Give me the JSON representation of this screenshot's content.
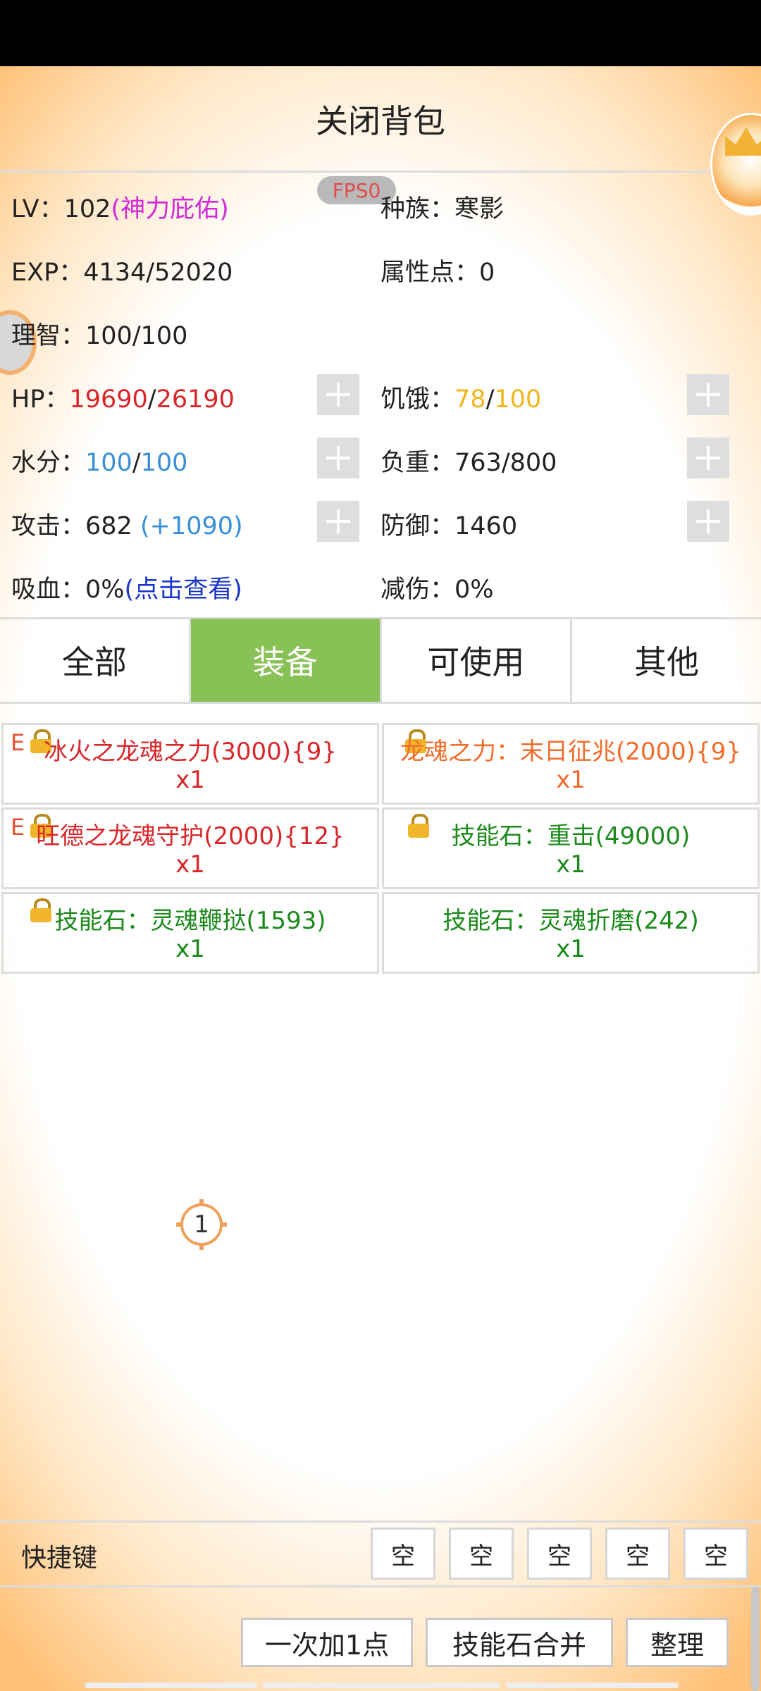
{
  "header": {
    "title": "关闭背包",
    "fps": "FPS0"
  },
  "stats": {
    "lv_label": "LV：",
    "lv_value": "102",
    "lv_buff": "(神力庇佑)",
    "race_label": "种族：",
    "race_value": "寒影",
    "exp_label": "EXP：",
    "exp_value": "4134/52020",
    "attr_label": "属性点：",
    "attr_value": "0",
    "sanity_label": "理智：",
    "sanity_value": "100/100",
    "hp_label": "HP：",
    "hp_current": "19690",
    "hp_sep": "/",
    "hp_max": "26190",
    "hunger_label": "饥饿：",
    "hunger_current": "78",
    "hunger_sep": "/",
    "hunger_max": "100",
    "water_label": "水分：",
    "water_current": "100",
    "water_sep": "/",
    "water_max": "100",
    "load_label": "负重：",
    "load_value": "763/800",
    "attack_label": "攻击：",
    "attack_value": "682",
    "attack_bonus": "(+1090)",
    "defense_label": "防御：",
    "defense_value": "1460",
    "lifesteal_label": "吸血：",
    "lifesteal_value": "0%",
    "lifesteal_link": "(点击查看)",
    "reduction_label": "减伤：",
    "reduction_value": "0%"
  },
  "tabs": [
    {
      "label": "全部",
      "active": false
    },
    {
      "label": "装备",
      "active": true
    },
    {
      "label": "可使用",
      "active": false
    },
    {
      "label": "其他",
      "active": false
    }
  ],
  "items": [
    {
      "name": "冰火之龙魂之力(3000){9}",
      "qty": "x1",
      "color": "#d8262a",
      "equipped": "E",
      "locked": true
    },
    {
      "name": "龙魂之力：末日征兆(2000){9}",
      "qty": "x1",
      "color": "#f26b2a",
      "equipped": "",
      "locked": true
    },
    {
      "name": "旺德之龙魂守护(2000){12}",
      "qty": "x1",
      "color": "#d8262a",
      "equipped": "E",
      "locked": true
    },
    {
      "name": "技能石：重击(49000)",
      "qty": "x1",
      "color": "#1b8a1b",
      "equipped": "",
      "locked": true
    },
    {
      "name": "技能石：灵魂鞭挞(1593)",
      "qty": "x1",
      "color": "#1b8a1b",
      "equipped": "",
      "locked": true
    },
    {
      "name": "技能石：灵魂折磨(242)",
      "qty": "x1",
      "color": "#1b8a1b",
      "equipped": "",
      "locked": false
    }
  ],
  "marker": {
    "number": "1"
  },
  "shortcut": {
    "label": "快捷键",
    "slots": [
      "空",
      "空",
      "空",
      "空",
      "空"
    ]
  },
  "buttons": {
    "add_one": "一次加1点",
    "merge_stones": "技能石合并",
    "sort": "整理"
  },
  "colors": {
    "active_tab": "#88c155",
    "hp": "#d8262a",
    "hunger": "#f2b61b",
    "water": "#3a8fd8",
    "buff": "#d12ad6",
    "link": "#1a35c8",
    "accent_bg": "#ffc27a"
  }
}
